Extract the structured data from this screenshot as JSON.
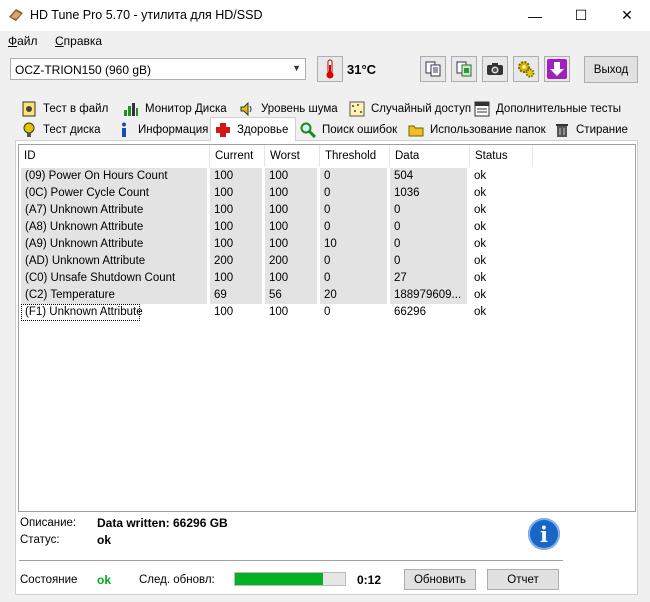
{
  "window": {
    "title": "HD Tune Pro 5.70 - утилита для HD/SSD",
    "minimize": "—",
    "maximize": "☐",
    "close": "✕"
  },
  "menu": {
    "file_u": "Ф",
    "file_rest": "айл",
    "help_u": "С",
    "help_rest": "правка"
  },
  "toolbar": {
    "drive": "OCZ-TRION150 (960 gB)",
    "temperature": "31°C",
    "exit_label": "Выход"
  },
  "tabs_row1": [
    {
      "label": "Тест в файл",
      "icon": "file-test-icon"
    },
    {
      "label": "Монитор Диска",
      "icon": "disk-monitor-icon"
    },
    {
      "label": "Уровень шума",
      "icon": "speaker-icon"
    },
    {
      "label": "Случайный доступ",
      "icon": "random-access-icon"
    },
    {
      "label": "Дополнительные  тесты",
      "icon": "extra-tests-icon"
    }
  ],
  "tabs_row2": [
    {
      "label": "Тест диска",
      "icon": "benchmark-icon"
    },
    {
      "label": "Информация",
      "icon": "info-icon"
    },
    {
      "label": "Здоровье",
      "icon": "health-cross-icon"
    },
    {
      "label": "Поиск ошибок",
      "icon": "magnifier-icon"
    },
    {
      "label": "Использование папок",
      "icon": "folder-icon"
    },
    {
      "label": "Стирание",
      "icon": "trash-icon"
    }
  ],
  "table": {
    "headers": [
      "ID",
      "Current",
      "Worst",
      "Threshold",
      "Data",
      "Status"
    ],
    "rows": [
      [
        "(09) Power On Hours Count",
        "100",
        "100",
        "0",
        "504",
        "ok"
      ],
      [
        "(0C) Power Cycle Count",
        "100",
        "100",
        "0",
        "1036",
        "ok"
      ],
      [
        "(A7) Unknown Attribute",
        "100",
        "100",
        "0",
        "0",
        "ok"
      ],
      [
        "(A8) Unknown Attribute",
        "100",
        "100",
        "0",
        "0",
        "ok"
      ],
      [
        "(A9) Unknown Attribute",
        "100",
        "100",
        "10",
        "0",
        "ok"
      ],
      [
        "(AD) Unknown Attribute",
        "200",
        "200",
        "0",
        "0",
        "ok"
      ],
      [
        "(C0) Unsafe Shutdown Count",
        "100",
        "100",
        "0",
        "27",
        "ok"
      ],
      [
        "(C2) Temperature",
        "69",
        "56",
        "20",
        "188979609...",
        "ok"
      ],
      [
        "(F1) Unknown Attribute",
        "100",
        "100",
        "0",
        "66296",
        "ok"
      ]
    ]
  },
  "details": {
    "description_label": "Описание:",
    "description_value": "Data written: 66296 GB",
    "status_label": "Статус:",
    "status_value": "ok"
  },
  "footer": {
    "state_label": "Состояние",
    "state_value": "ok",
    "next_update_label": "След. обновл:",
    "progress": 0.8,
    "timer": "0:12",
    "refresh_label": "Обновить",
    "report_label": "Отчет"
  },
  "colors": {
    "ok_green": "#05a820",
    "progress_green": "#06b025",
    "selection_shade": "#e3e3e3"
  }
}
